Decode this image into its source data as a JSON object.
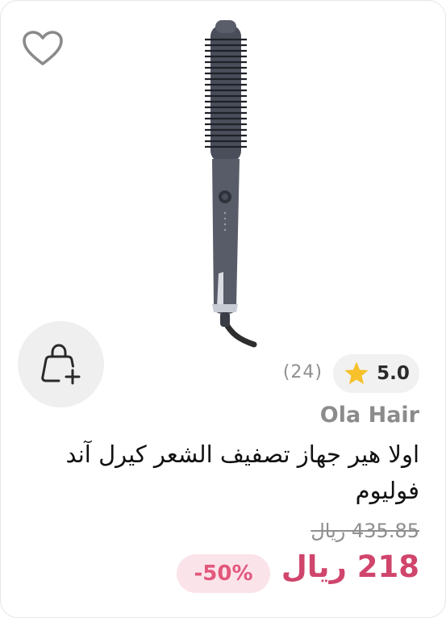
{
  "product": {
    "rating": "5.0",
    "review_count": "(24)",
    "brand": "Ola Hair",
    "title": "اولا هير جهاز تصفيف الشعر كيرل آند فوليوم",
    "old_price": "435.85 ريال",
    "new_price": "218 ريال",
    "discount": "-50%"
  },
  "icons": {
    "wishlist": "heart-outline-icon",
    "cart": "shopping-bag-plus-icon",
    "rating": "star-icon"
  },
  "colors": {
    "price": "#d0456c",
    "discount_text": "#e2587d",
    "discount_bg": "#fbe3ea",
    "star": "#f6c12b"
  }
}
